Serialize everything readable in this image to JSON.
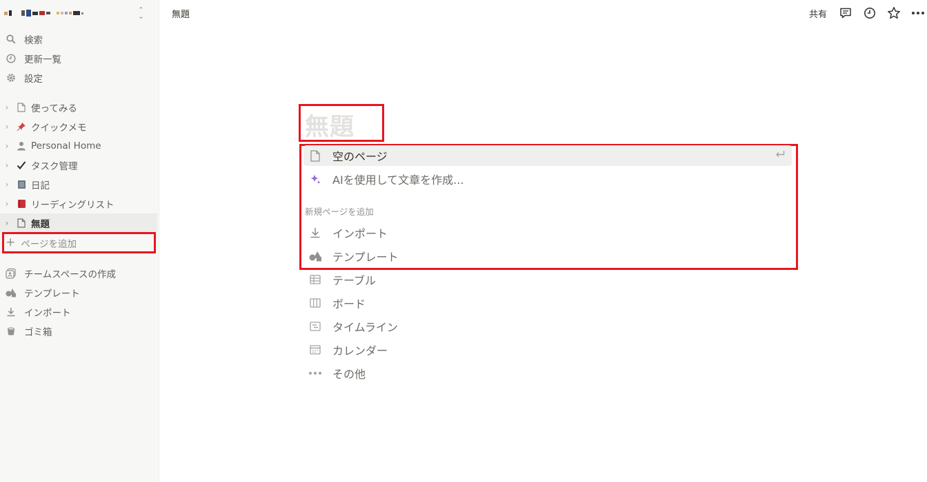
{
  "sidebar": {
    "workspace_chevron": "⌃⌄",
    "nav": [
      {
        "label": "検索",
        "icon": "search-icon"
      },
      {
        "label": "更新一覧",
        "icon": "clock-icon"
      },
      {
        "label": "設定",
        "icon": "gear-icon"
      }
    ],
    "pages": [
      {
        "label": "使ってみる",
        "icon": "page-icon"
      },
      {
        "label": "クイックメモ",
        "icon": "pushpin-icon"
      },
      {
        "label": "Personal Home",
        "icon": "person-icon"
      },
      {
        "label": "タスク管理",
        "icon": "checkmark-icon"
      },
      {
        "label": "日記",
        "icon": "notebook-icon"
      },
      {
        "label": "リーディングリスト",
        "icon": "red-book-icon"
      },
      {
        "label": "無題",
        "icon": "page-icon"
      }
    ],
    "add_page": "ページを追加",
    "bottom": [
      {
        "label": "チームスペースの作成",
        "icon": "teamspace-icon"
      },
      {
        "label": "テンプレート",
        "icon": "shapes-icon"
      },
      {
        "label": "インポート",
        "icon": "download-icon"
      },
      {
        "label": "ゴミ箱",
        "icon": "trash-icon"
      }
    ]
  },
  "topbar": {
    "title": "無題",
    "share": "共有"
  },
  "main": {
    "title_placeholder": "無題",
    "menu_top": [
      {
        "label": "空のページ",
        "icon": "page-icon"
      },
      {
        "label": "AIを使用して文章を作成...",
        "icon": "sparkle-icon"
      }
    ],
    "section_label": "新規ページを追加",
    "menu_add": [
      {
        "label": "インポート",
        "icon": "download-icon"
      },
      {
        "label": "テンプレート",
        "icon": "shapes-icon"
      },
      {
        "label": "テーブル",
        "icon": "table-icon"
      },
      {
        "label": "ボード",
        "icon": "board-icon"
      },
      {
        "label": "タイムライン",
        "icon": "timeline-icon"
      },
      {
        "label": "カレンダー",
        "icon": "calendar-icon"
      },
      {
        "label": "その他",
        "icon": "more-icon"
      }
    ]
  },
  "colors": {
    "highlight": "#e8151f",
    "sidebar_bg": "#f7f7f5",
    "accent_purple": "#9b6bd6"
  }
}
